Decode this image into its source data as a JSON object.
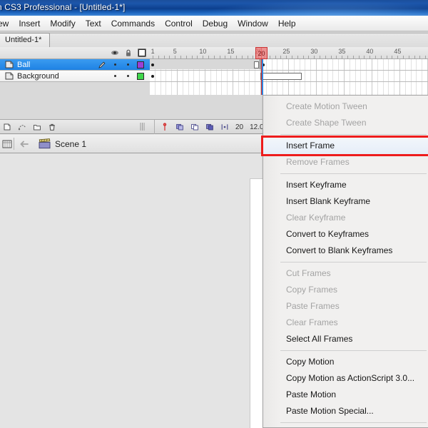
{
  "window": {
    "title": "n CS3 Professional - [Untitled-1*]"
  },
  "menubar": {
    "items": [
      {
        "label": "ew"
      },
      {
        "label": "Insert"
      },
      {
        "label": "Modify"
      },
      {
        "label": "Text"
      },
      {
        "label": "Commands"
      },
      {
        "label": "Control"
      },
      {
        "label": "Debug"
      },
      {
        "label": "Window"
      },
      {
        "label": "Help"
      }
    ]
  },
  "document_tabs": {
    "active_tab": "Untitled-1*"
  },
  "timeline": {
    "header_icons": [
      "eye-icon",
      "lock-icon",
      "outline-square-icon"
    ],
    "ruler_ticks": [
      {
        "label": "1",
        "frame": 1
      },
      {
        "label": "5",
        "frame": 5
      },
      {
        "label": "10",
        "frame": 10
      },
      {
        "label": "15",
        "frame": 15
      },
      {
        "label": "20",
        "frame": 20
      },
      {
        "label": "25",
        "frame": 25
      },
      {
        "label": "30",
        "frame": 30
      },
      {
        "label": "35",
        "frame": 35
      },
      {
        "label": "40",
        "frame": 40
      },
      {
        "label": "45",
        "frame": 45
      }
    ],
    "playhead_frame": "20",
    "layers": [
      {
        "name": "Ball",
        "selected": true,
        "color": "#9b3fd6",
        "editing": true
      },
      {
        "name": "Background",
        "selected": false,
        "color": "#3fd64a",
        "editing": false
      }
    ],
    "status": {
      "current_frame": "20",
      "frame_rate": "12.0",
      "elapsed": ""
    },
    "bottom_tools": [
      "insert-layer-icon",
      "add-motion-guide-icon",
      "insert-folder-icon",
      "delete-layer-icon"
    ],
    "playback_tools": [
      "center-frame-icon",
      "onion-skin-icon",
      "onion-skin-outlines-icon",
      "edit-multiple-frames-icon",
      "modify-onion-markers-icon"
    ]
  },
  "scenebar": {
    "back_icon": "back-arrow-icon",
    "edit_scene_icon": "timeline-toggle-icon",
    "scene_icon": "clapperboard-icon",
    "scene_label": "Scene 1"
  },
  "context_menu": {
    "highlighted": "Insert Frame",
    "groups": [
      {
        "items": [
          {
            "label": "Create Motion Tween",
            "disabled": true,
            "highlighted": false
          },
          {
            "label": "Create Shape Tween",
            "disabled": true,
            "highlighted": false
          }
        ]
      },
      {
        "items": [
          {
            "label": "Insert Frame",
            "disabled": false,
            "highlighted": true
          },
          {
            "label": "Remove Frames",
            "disabled": true,
            "highlighted": false
          }
        ]
      },
      {
        "items": [
          {
            "label": "Insert Keyframe",
            "disabled": false,
            "highlighted": false
          },
          {
            "label": "Insert Blank Keyframe",
            "disabled": false,
            "highlighted": false
          },
          {
            "label": "Clear Keyframe",
            "disabled": true,
            "highlighted": false
          },
          {
            "label": "Convert to Keyframes",
            "disabled": false,
            "highlighted": false
          },
          {
            "label": "Convert to Blank Keyframes",
            "disabled": false,
            "highlighted": false
          }
        ]
      },
      {
        "items": [
          {
            "label": "Cut Frames",
            "disabled": true,
            "highlighted": false
          },
          {
            "label": "Copy Frames",
            "disabled": true,
            "highlighted": false
          },
          {
            "label": "Paste Frames",
            "disabled": true,
            "highlighted": false
          },
          {
            "label": "Clear Frames",
            "disabled": true,
            "highlighted": false
          },
          {
            "label": "Select All Frames",
            "disabled": false,
            "highlighted": false
          }
        ]
      },
      {
        "items": [
          {
            "label": "Copy Motion",
            "disabled": false,
            "highlighted": false
          },
          {
            "label": "Copy Motion as ActionScript 3.0...",
            "disabled": false,
            "highlighted": false
          },
          {
            "label": "Paste Motion",
            "disabled": false,
            "highlighted": false
          },
          {
            "label": "Paste Motion Special...",
            "disabled": false,
            "highlighted": false
          }
        ]
      }
    ]
  },
  "colors": {
    "title_bar": "#10428f",
    "highlight_red": "#ee1c1c",
    "layer_selected": "#2283e4",
    "playhead": "#d42b2b"
  }
}
